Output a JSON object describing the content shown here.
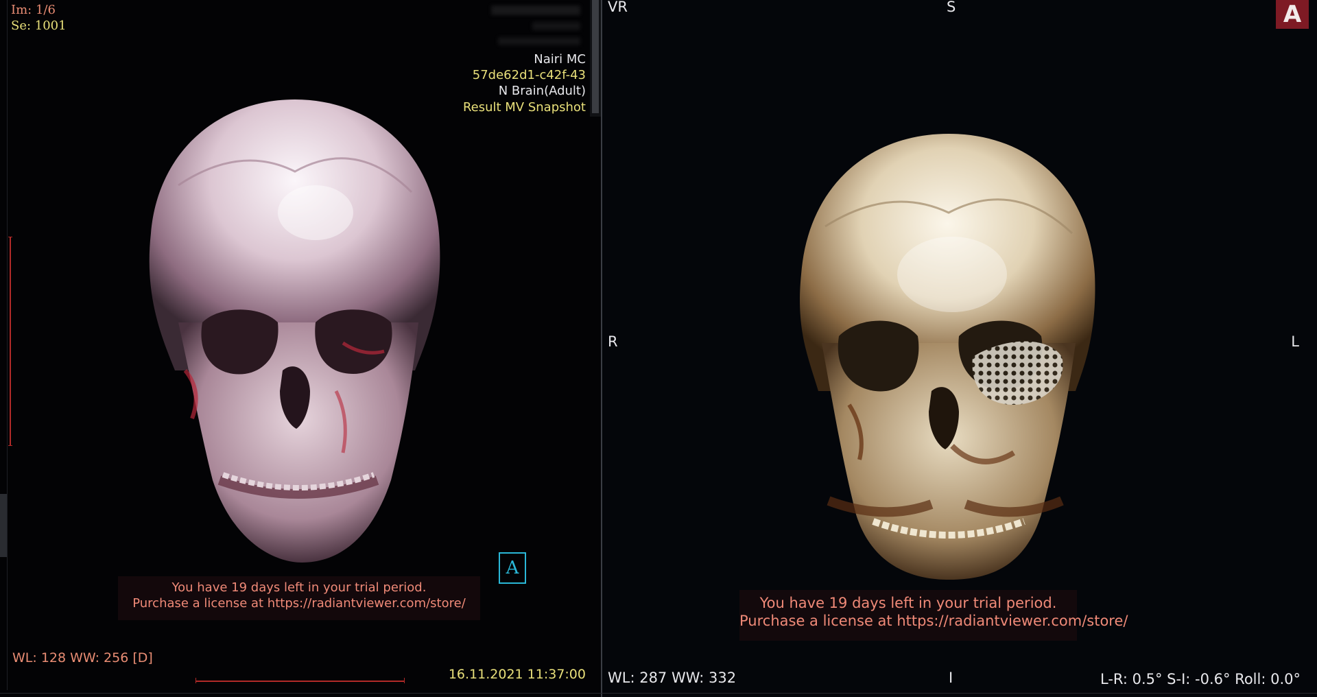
{
  "left_viewport": {
    "image_counter": "Im: 1/6",
    "series": "Se: 1001",
    "institution": "Nairi MC",
    "study_id": "57de62d1-c42f-43",
    "protocol": "N Brain(Adult)",
    "description": "Result MV Snapshot",
    "window_level": "WL: 128 WW: 256 [D]",
    "datetime": "16.11.2021 11:37:00",
    "trial_line_1": "You have 19 days left in your trial period.",
    "trial_line_2": "Purchase a license at https://radiantviewer.com/store/",
    "annotation_icon_letter": "A",
    "skull_tint": "#e8d6e0",
    "icon": "skull-3d-render"
  },
  "right_viewport": {
    "mode": "VR",
    "orientation_top": "S",
    "orientation_left": "R",
    "orientation_right": "L",
    "orientation_bottom": "I",
    "window_level": "WL: 287 WW: 332",
    "rotation": "L-R: 0.5° S-I: -0.6° Roll: 0.0°",
    "trial_line_1": "You have 19 days left in your trial period.",
    "trial_line_2": "Purchase a license at https://radiantviewer.com/store/",
    "logo_letter": "A",
    "skull_tint": "#efe6cf",
    "icon": "skull-3d-render-with-implant"
  },
  "colors": {
    "overlay_yellow": "#e9e07a",
    "overlay_salmon": "#ea8d74",
    "overlay_white": "#e8e8ec",
    "trial_text": "#f08a78",
    "logo_bg": "#7e1a24",
    "annotation_cyan": "#2ab8d8"
  }
}
